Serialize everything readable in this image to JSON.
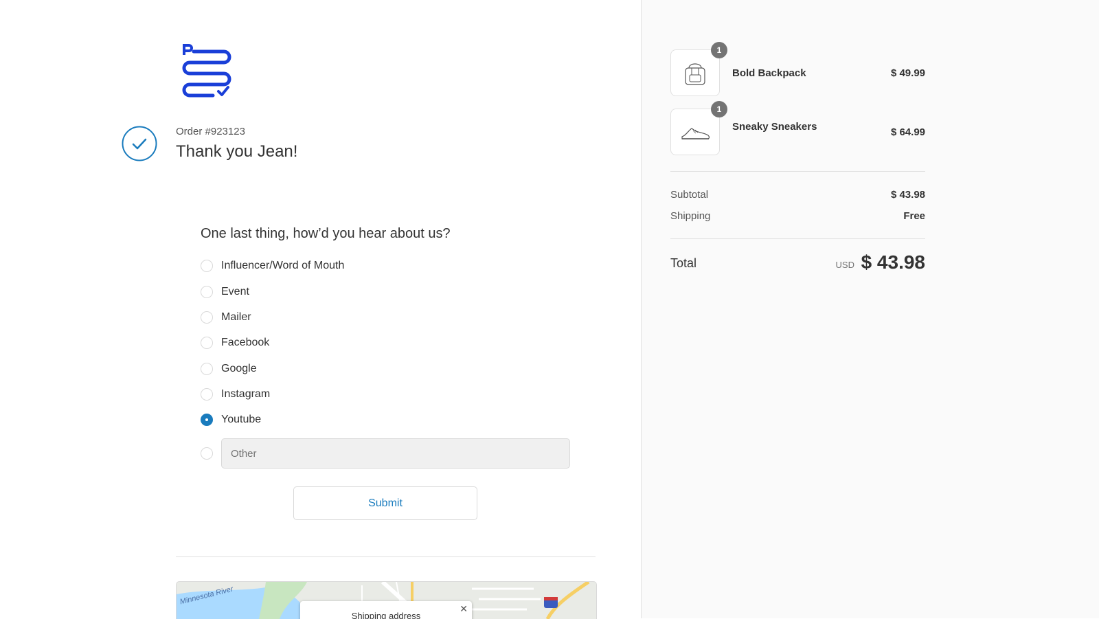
{
  "order": {
    "number": "Order #923123",
    "thank_you": "Thank you Jean!"
  },
  "survey": {
    "question": "One last thing, how’d you hear about us?",
    "options": [
      "Influencer/Word of Mouth",
      "Event",
      "Mailer",
      "Facebook",
      "Google",
      "Instagram",
      "Youtube"
    ],
    "selected": "Youtube",
    "other_placeholder": "Other",
    "submit_label": "Submit"
  },
  "map": {
    "popup_title": "Shipping address",
    "river_label": "Minnesota River"
  },
  "cart": {
    "items": [
      {
        "name": "Bold Backpack",
        "price": "$ 49.99",
        "quantity": "1",
        "icon": "backpack-icon"
      },
      {
        "name": "Sneaky Sneakers",
        "price": "$ 64.99",
        "quantity": "1",
        "icon": "sneaker-icon"
      }
    ],
    "subtotal_label": "Subtotal",
    "subtotal_value": "$ 43.98",
    "shipping_label": "Shipping",
    "shipping_value": "Free",
    "total_label": "Total",
    "total_currency": "USD",
    "total_value": "$ 43.98"
  },
  "colors": {
    "accent": "#197bbd",
    "logo": "#1a3fd8"
  }
}
